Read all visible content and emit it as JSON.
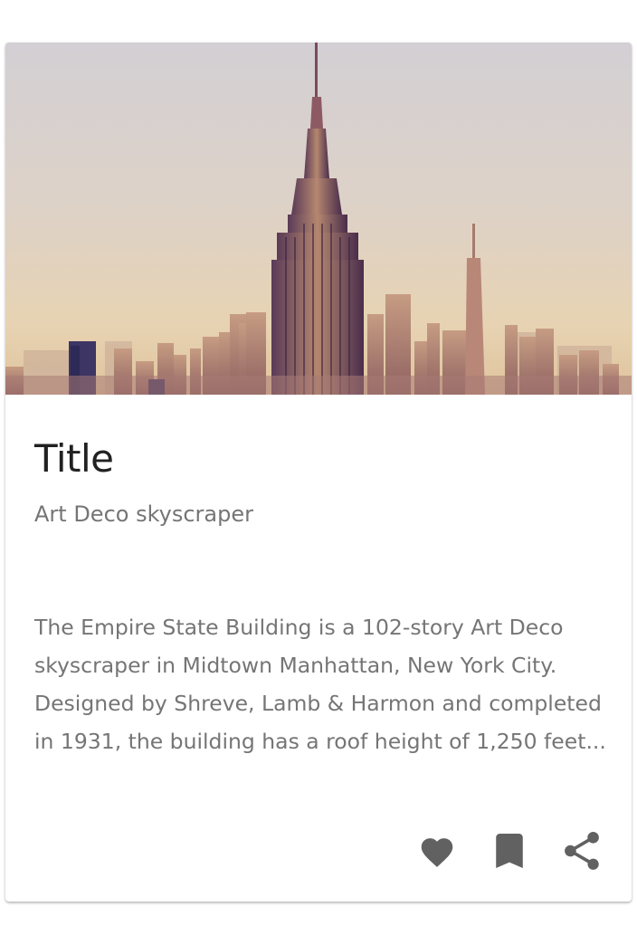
{
  "card": {
    "image": {
      "subject": "Empire State Building skyline photo",
      "tint": "#c9a27a"
    },
    "title": "Title",
    "subtitle": "Art Deco skyscraper",
    "body": "The Empire State Building is a 102-story Art Deco skyscraper in Midtown Manhattan, New York City. Designed by Shreve, Lamb & Harmon and completed in 1931, the building has a roof height of 1,250 feet...",
    "actions": [
      {
        "icon": "heart-icon"
      },
      {
        "icon": "bookmark-icon"
      },
      {
        "icon": "share-icon"
      }
    ]
  },
  "colors": {
    "title": "#212121",
    "text_secondary": "#757575",
    "icon": "#616161"
  }
}
